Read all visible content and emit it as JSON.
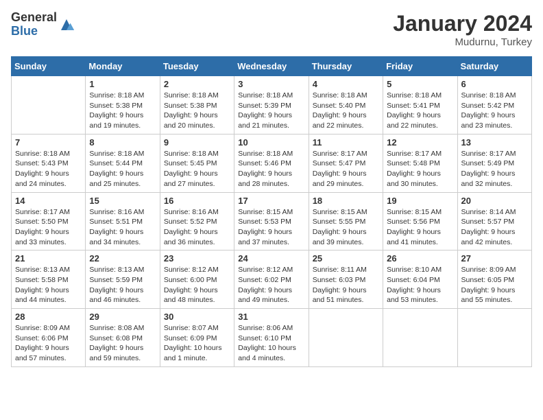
{
  "logo": {
    "general": "General",
    "blue": "Blue"
  },
  "header": {
    "title": "January 2024",
    "location": "Mudurnu, Turkey"
  },
  "days_of_week": [
    "Sunday",
    "Monday",
    "Tuesday",
    "Wednesday",
    "Thursday",
    "Friday",
    "Saturday"
  ],
  "weeks": [
    [
      {
        "day": "",
        "info": ""
      },
      {
        "day": "1",
        "info": "Sunrise: 8:18 AM\nSunset: 5:38 PM\nDaylight: 9 hours\nand 19 minutes."
      },
      {
        "day": "2",
        "info": "Sunrise: 8:18 AM\nSunset: 5:38 PM\nDaylight: 9 hours\nand 20 minutes."
      },
      {
        "day": "3",
        "info": "Sunrise: 8:18 AM\nSunset: 5:39 PM\nDaylight: 9 hours\nand 21 minutes."
      },
      {
        "day": "4",
        "info": "Sunrise: 8:18 AM\nSunset: 5:40 PM\nDaylight: 9 hours\nand 22 minutes."
      },
      {
        "day": "5",
        "info": "Sunrise: 8:18 AM\nSunset: 5:41 PM\nDaylight: 9 hours\nand 22 minutes."
      },
      {
        "day": "6",
        "info": "Sunrise: 8:18 AM\nSunset: 5:42 PM\nDaylight: 9 hours\nand 23 minutes."
      }
    ],
    [
      {
        "day": "7",
        "info": "Sunrise: 8:18 AM\nSunset: 5:43 PM\nDaylight: 9 hours\nand 24 minutes."
      },
      {
        "day": "8",
        "info": "Sunrise: 8:18 AM\nSunset: 5:44 PM\nDaylight: 9 hours\nand 25 minutes."
      },
      {
        "day": "9",
        "info": "Sunrise: 8:18 AM\nSunset: 5:45 PM\nDaylight: 9 hours\nand 27 minutes."
      },
      {
        "day": "10",
        "info": "Sunrise: 8:18 AM\nSunset: 5:46 PM\nDaylight: 9 hours\nand 28 minutes."
      },
      {
        "day": "11",
        "info": "Sunrise: 8:17 AM\nSunset: 5:47 PM\nDaylight: 9 hours\nand 29 minutes."
      },
      {
        "day": "12",
        "info": "Sunrise: 8:17 AM\nSunset: 5:48 PM\nDaylight: 9 hours\nand 30 minutes."
      },
      {
        "day": "13",
        "info": "Sunrise: 8:17 AM\nSunset: 5:49 PM\nDaylight: 9 hours\nand 32 minutes."
      }
    ],
    [
      {
        "day": "14",
        "info": "Sunrise: 8:17 AM\nSunset: 5:50 PM\nDaylight: 9 hours\nand 33 minutes."
      },
      {
        "day": "15",
        "info": "Sunrise: 8:16 AM\nSunset: 5:51 PM\nDaylight: 9 hours\nand 34 minutes."
      },
      {
        "day": "16",
        "info": "Sunrise: 8:16 AM\nSunset: 5:52 PM\nDaylight: 9 hours\nand 36 minutes."
      },
      {
        "day": "17",
        "info": "Sunrise: 8:15 AM\nSunset: 5:53 PM\nDaylight: 9 hours\nand 37 minutes."
      },
      {
        "day": "18",
        "info": "Sunrise: 8:15 AM\nSunset: 5:55 PM\nDaylight: 9 hours\nand 39 minutes."
      },
      {
        "day": "19",
        "info": "Sunrise: 8:15 AM\nSunset: 5:56 PM\nDaylight: 9 hours\nand 41 minutes."
      },
      {
        "day": "20",
        "info": "Sunrise: 8:14 AM\nSunset: 5:57 PM\nDaylight: 9 hours\nand 42 minutes."
      }
    ],
    [
      {
        "day": "21",
        "info": "Sunrise: 8:13 AM\nSunset: 5:58 PM\nDaylight: 9 hours\nand 44 minutes."
      },
      {
        "day": "22",
        "info": "Sunrise: 8:13 AM\nSunset: 5:59 PM\nDaylight: 9 hours\nand 46 minutes."
      },
      {
        "day": "23",
        "info": "Sunrise: 8:12 AM\nSunset: 6:00 PM\nDaylight: 9 hours\nand 48 minutes."
      },
      {
        "day": "24",
        "info": "Sunrise: 8:12 AM\nSunset: 6:02 PM\nDaylight: 9 hours\nand 49 minutes."
      },
      {
        "day": "25",
        "info": "Sunrise: 8:11 AM\nSunset: 6:03 PM\nDaylight: 9 hours\nand 51 minutes."
      },
      {
        "day": "26",
        "info": "Sunrise: 8:10 AM\nSunset: 6:04 PM\nDaylight: 9 hours\nand 53 minutes."
      },
      {
        "day": "27",
        "info": "Sunrise: 8:09 AM\nSunset: 6:05 PM\nDaylight: 9 hours\nand 55 minutes."
      }
    ],
    [
      {
        "day": "28",
        "info": "Sunrise: 8:09 AM\nSunset: 6:06 PM\nDaylight: 9 hours\nand 57 minutes."
      },
      {
        "day": "29",
        "info": "Sunrise: 8:08 AM\nSunset: 6:08 PM\nDaylight: 9 hours\nand 59 minutes."
      },
      {
        "day": "30",
        "info": "Sunrise: 8:07 AM\nSunset: 6:09 PM\nDaylight: 10 hours\nand 1 minute."
      },
      {
        "day": "31",
        "info": "Sunrise: 8:06 AM\nSunset: 6:10 PM\nDaylight: 10 hours\nand 4 minutes."
      },
      {
        "day": "",
        "info": ""
      },
      {
        "day": "",
        "info": ""
      },
      {
        "day": "",
        "info": ""
      }
    ]
  ]
}
